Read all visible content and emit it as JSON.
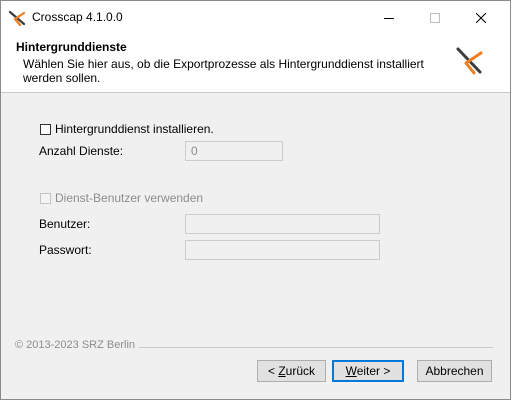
{
  "window": {
    "title": "Crosscap 4.1.0.0"
  },
  "header": {
    "title": "Hintergrunddienste",
    "description": "Wählen Sie hier aus, ob die Exportprozesse als Hintergrunddienst installiert werden sollen."
  },
  "form": {
    "install_checkbox_label": "Hintergrunddienst installieren.",
    "install_checked": false,
    "service_count_label": "Anzahl Dienste:",
    "service_count_value": "0",
    "service_user_checkbox_label": "Dienst-Benutzer verwenden",
    "service_user_checked": false,
    "user_label": "Benutzer:",
    "user_value": "",
    "password_label": "Passwort:",
    "password_value": ""
  },
  "footer": {
    "copyright": "© 2013-2023 SRZ Berlin"
  },
  "buttons": {
    "back": {
      "pre": "< ",
      "key": "Z",
      "post": "urück"
    },
    "next": {
      "pre": "",
      "key": "W",
      "post": "eiter >"
    },
    "cancel": "Abbrechen"
  },
  "colors": {
    "logo_orange": "#f07d1e",
    "logo_dark": "#3c3c3c",
    "focus_blue": "#0078d7"
  },
  "icons": {
    "app": "crosscap-logo-icon",
    "minimize": "minimize-icon",
    "maximize": "maximize-icon",
    "close": "close-icon"
  }
}
